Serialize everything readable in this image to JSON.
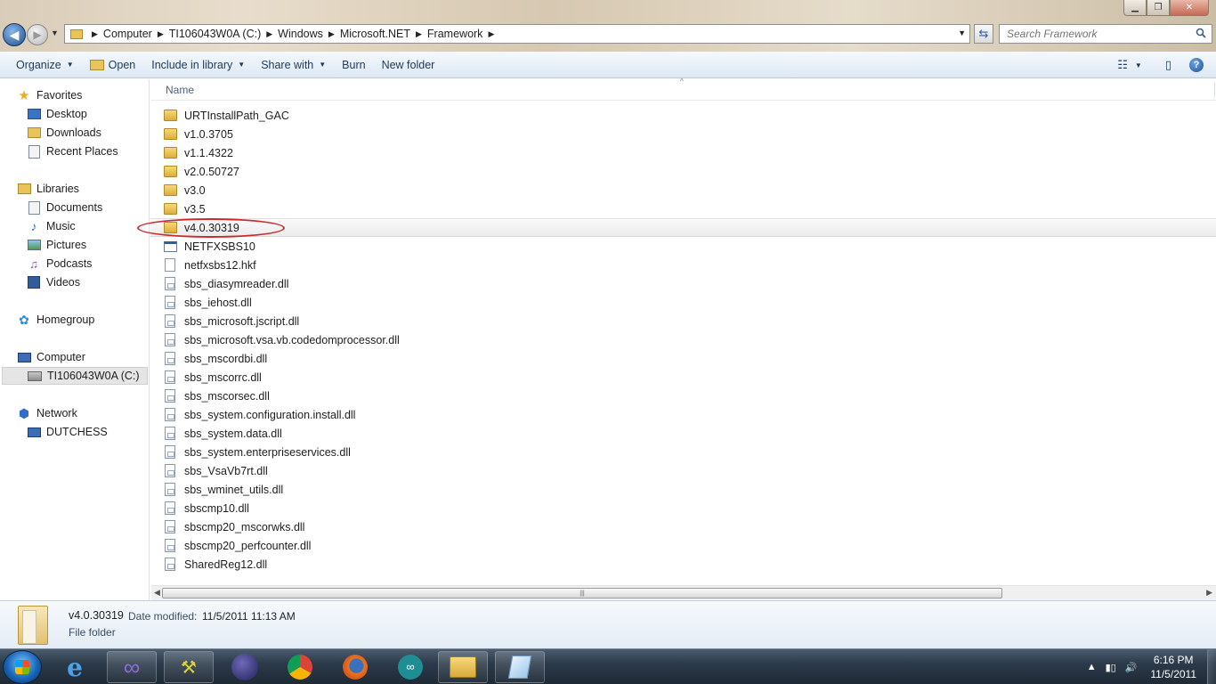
{
  "window": {
    "controls": {
      "minimize": "▁",
      "maximize": "❐",
      "close": "✕"
    }
  },
  "nav": {
    "back": "◀",
    "forward": "▶",
    "recent": "▼"
  },
  "address": {
    "crumbs": [
      "Computer",
      "TI106043W0A (C:)",
      "Windows",
      "Microsoft.NET",
      "Framework"
    ],
    "separator": "▶",
    "dropdown": "▼",
    "refresh": "⇆"
  },
  "search": {
    "placeholder": "Search Framework"
  },
  "toolbar": {
    "organize": "Organize",
    "open": "Open",
    "include_in_library": "Include in library",
    "share_with": "Share with",
    "burn": "Burn",
    "new_folder": "New folder",
    "caret": "▼",
    "view_icon": "☷",
    "preview_icon": "▯",
    "help": "?"
  },
  "sidebar": {
    "favorites": {
      "label": "Favorites",
      "items": [
        "Desktop",
        "Downloads",
        "Recent Places"
      ]
    },
    "libraries": {
      "label": "Libraries",
      "items": [
        "Documents",
        "Music",
        "Pictures",
        "Podcasts",
        "Videos"
      ]
    },
    "homegroup": "Homegroup",
    "computer": {
      "label": "Computer",
      "items": [
        "TI106043W0A (C:)"
      ]
    },
    "network": {
      "label": "Network",
      "items": [
        "DUTCHESS"
      ]
    }
  },
  "content": {
    "column_name": "Name",
    "sort_indicator": "^",
    "files": [
      {
        "name": "URTInstallPath_GAC",
        "type": "folder"
      },
      {
        "name": "v1.0.3705",
        "type": "folder"
      },
      {
        "name": "v1.1.4322",
        "type": "folder"
      },
      {
        "name": "v2.0.50727",
        "type": "folder"
      },
      {
        "name": "v3.0",
        "type": "folder"
      },
      {
        "name": "v3.5",
        "type": "folder"
      },
      {
        "name": "v4.0.30319",
        "type": "folder"
      },
      {
        "name": "NETFXSBS10",
        "type": "exe"
      },
      {
        "name": "netfxsbs12.hkf",
        "type": "file"
      },
      {
        "name": "sbs_diasymreader.dll",
        "type": "dll"
      },
      {
        "name": "sbs_iehost.dll",
        "type": "dll"
      },
      {
        "name": "sbs_microsoft.jscript.dll",
        "type": "dll"
      },
      {
        "name": "sbs_microsoft.vsa.vb.codedomprocessor.dll",
        "type": "dll"
      },
      {
        "name": "sbs_mscordbi.dll",
        "type": "dll"
      },
      {
        "name": "sbs_mscorrc.dll",
        "type": "dll"
      },
      {
        "name": "sbs_mscorsec.dll",
        "type": "dll"
      },
      {
        "name": "sbs_system.configuration.install.dll",
        "type": "dll"
      },
      {
        "name": "sbs_system.data.dll",
        "type": "dll"
      },
      {
        "name": "sbs_system.enterpriseservices.dll",
        "type": "dll"
      },
      {
        "name": "sbs_VsaVb7rt.dll",
        "type": "dll"
      },
      {
        "name": "sbs_wminet_utils.dll",
        "type": "dll"
      },
      {
        "name": "sbscmp10.dll",
        "type": "dll"
      },
      {
        "name": "sbscmp20_mscorwks.dll",
        "type": "dll"
      },
      {
        "name": "sbscmp20_perfcounter.dll",
        "type": "dll"
      },
      {
        "name": "SharedReg12.dll",
        "type": "dll"
      }
    ],
    "hovered_index": 6,
    "scroll": {
      "left": "◀",
      "right": "▶",
      "grip": "|||"
    }
  },
  "details": {
    "name": "v4.0.30319",
    "modified_label": "Date modified:",
    "modified_value": "11/5/2011 11:13 AM",
    "type": "File folder"
  },
  "taskbar": {
    "clock_time": "6:16 PM",
    "clock_date": "11/5/2011",
    "tray_arrow": "▲",
    "tray_volume": "🔊",
    "tray_network": "▮▯"
  },
  "colors": {
    "annotation": "#cc2a2a",
    "accent": "#1e395b"
  }
}
